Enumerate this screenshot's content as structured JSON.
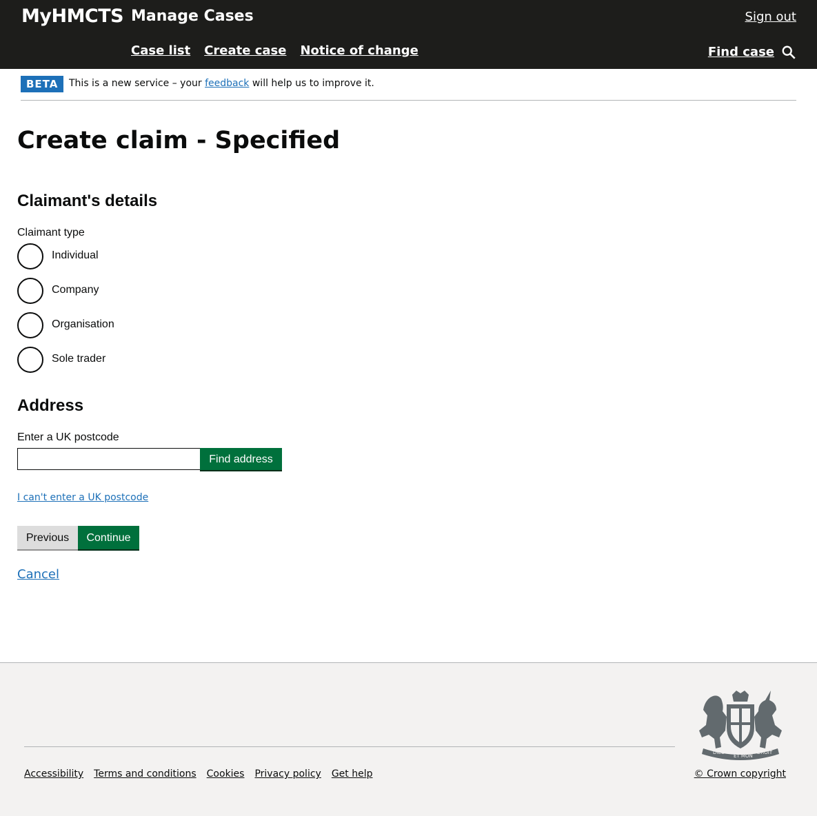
{
  "header": {
    "brand": "MyHMCTS",
    "service": "Manage Cases",
    "sign_out": "Sign out",
    "nav": [
      {
        "label": "Case list"
      },
      {
        "label": "Create case"
      },
      {
        "label": "Notice of change"
      }
    ],
    "find_case": "Find case",
    "search_icon": "search-icon"
  },
  "beta": {
    "tag": "BETA",
    "text_before": "This is a new service – your ",
    "link": "feedback",
    "text_after": " will help us to improve it."
  },
  "page": {
    "title": "Create claim - Specified",
    "claimant_heading": "Claimant's details",
    "claimant_type_label": "Claimant type",
    "claimant_types": [
      "Individual",
      "Company",
      "Organisation",
      "Sole trader"
    ],
    "address_heading": "Address",
    "postcode_label": "Enter a UK postcode",
    "postcode_value": "",
    "find_address": "Find address",
    "cant_enter": "I can't enter a UK postcode",
    "previous": "Previous",
    "continue": "Continue",
    "cancel": "Cancel"
  },
  "footer": {
    "links": [
      "Accessibility",
      "Terms and conditions",
      "Cookies",
      "Privacy policy",
      "Get help"
    ],
    "copyright": "© Crown copyright",
    "crest": "royal-coat-of-arms",
    "crest_text": [
      "DIEU",
      "ET MON",
      "DROIT"
    ]
  },
  "colors": {
    "header_bg": "#1d1d1b",
    "link": "#1d70b8",
    "primary_button": "#00703c",
    "secondary_button": "#dddddd",
    "footer_bg": "#f3f2f1"
  }
}
